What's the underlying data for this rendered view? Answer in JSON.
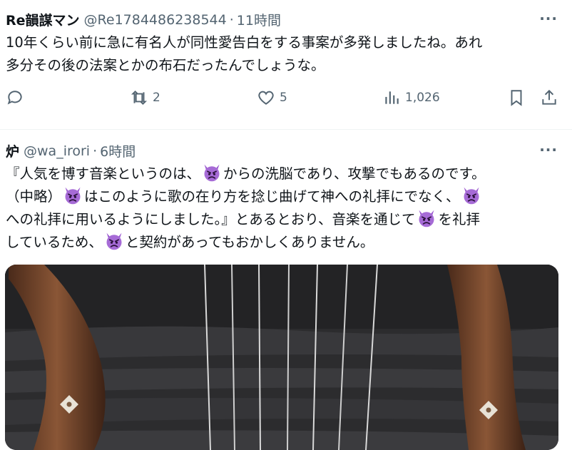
{
  "post1": {
    "display_name": "Re韻謀マン",
    "handle": "@Re1784486238544",
    "separator": "·",
    "time": "11時間",
    "more": "···",
    "line1": "10年くらい前に急に有名人が同性愛告白をする事案が多発しましたね。あれ",
    "line2": "多分その後の法案とかの布石だったんでしょうな。",
    "actions": {
      "reply_icon": "reply-icon",
      "retweet_count": "2",
      "like_count": "5",
      "views_count": "1,026",
      "bookmark_icon": "bookmark-icon",
      "share_icon": "share-icon"
    }
  },
  "post2": {
    "display_name": "炉",
    "handle": "@wa_irori",
    "separator": "·",
    "time": "6時間",
    "more": "···",
    "l1a": "『人気を博す音楽というのは、",
    "l1b": "からの洗脳であり、攻撃でもあるのです。",
    "l2a": "（中略）",
    "l2b": "はこのように歌の在り方を捻じ曲げて神への礼拝にでなく、",
    "l3a": "への礼拝に用いるようにしました。』とあるとおり、音楽を通じて",
    "l3b": "を礼拝",
    "l4a": "しているため、",
    "l4b": "と契約があってもおかしくありません。",
    "emoji": "angry-devil-emoji",
    "accent_color": "#9b59d0"
  }
}
